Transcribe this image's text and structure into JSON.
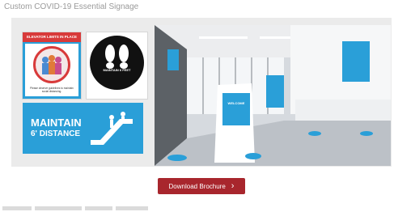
{
  "page": {
    "title": "Custom COVID-19 Essential Signage"
  },
  "signs": {
    "elevator": {
      "header": "ELEVATOR LIMITS IN PLACE",
      "note": "Please observe guidelines to maintain social distancing."
    },
    "feet": {
      "text": "MAINTAIN 6 FEET"
    },
    "distance": {
      "line1": "MAINTAIN",
      "line2": "6' DISTANCE"
    }
  },
  "room": {
    "kiosk_text": "WELCOME"
  },
  "actions": {
    "download_label": "Download Brochure",
    "download_icon": "chevron-right-icon"
  },
  "colors": {
    "accent_blue": "#2a9fd8",
    "button_red": "#a8262d",
    "sign_red": "#d83a3a"
  }
}
